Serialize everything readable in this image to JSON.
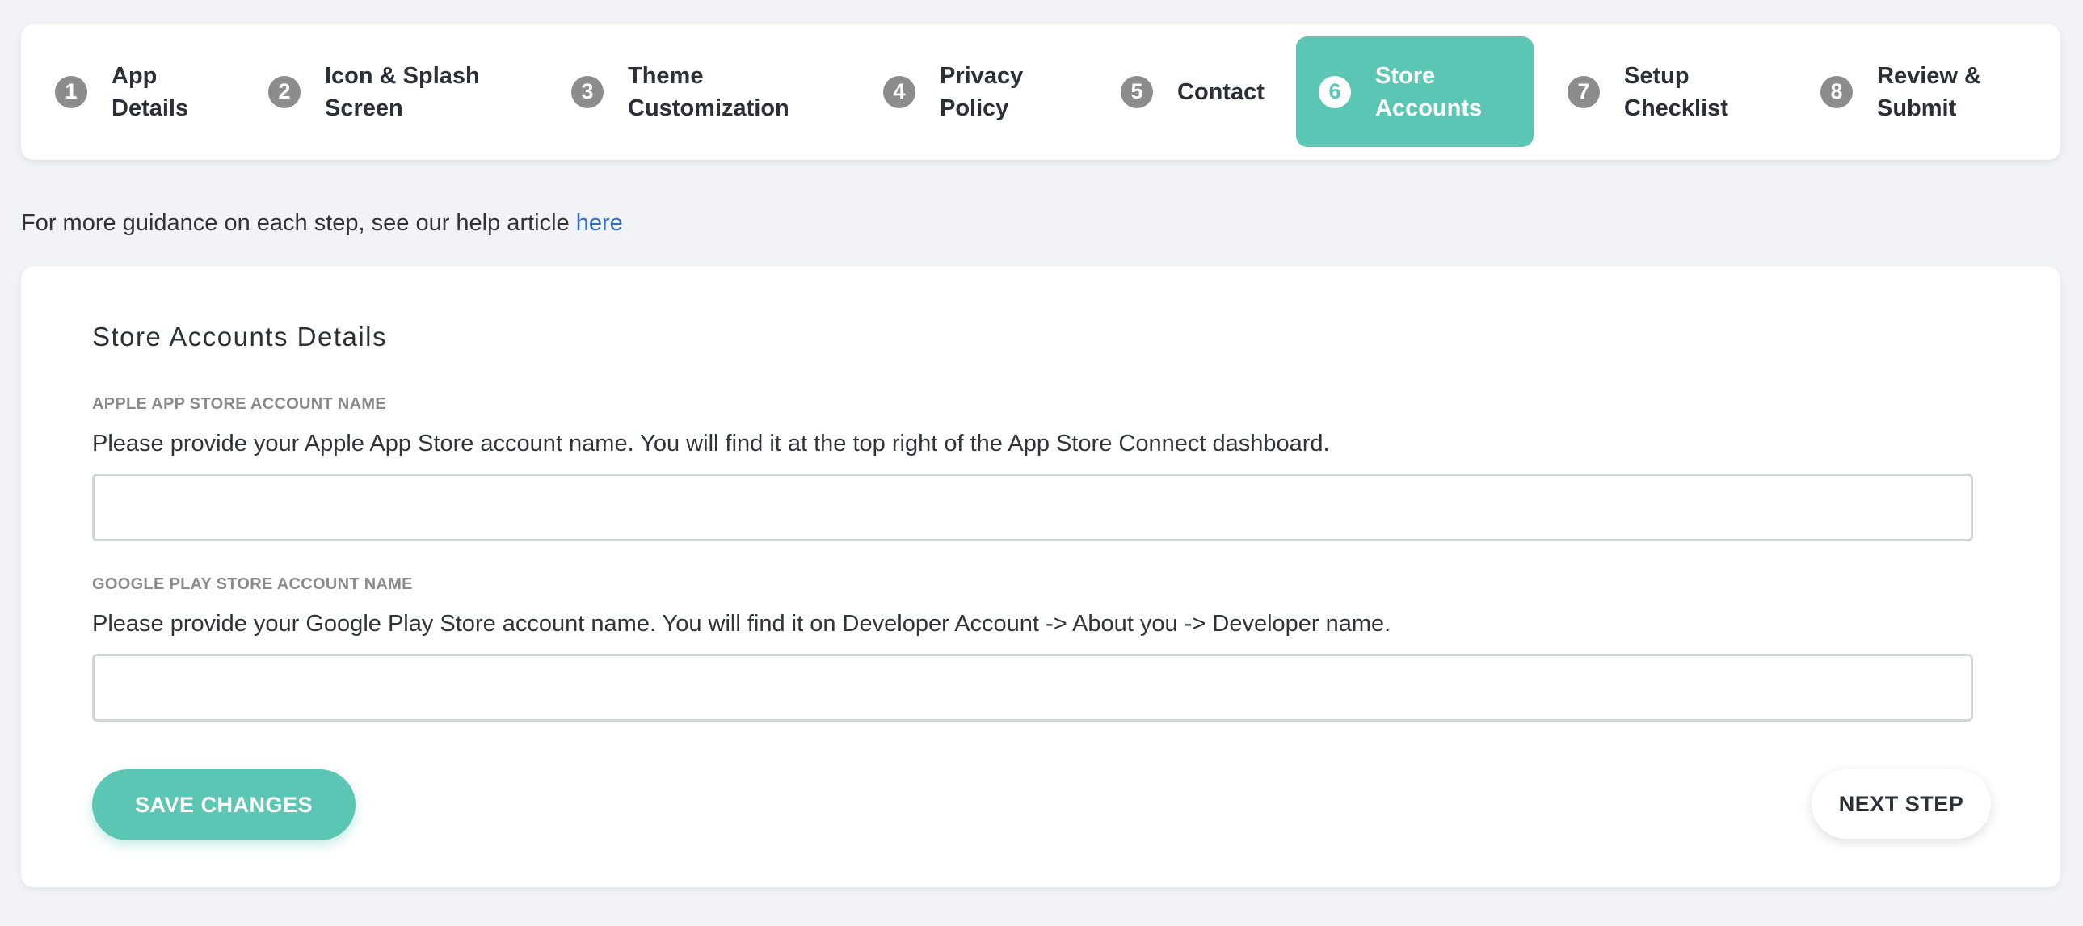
{
  "stepper": {
    "steps": [
      {
        "number": "1",
        "label_line1": "App",
        "label_line2": "Details",
        "active": false
      },
      {
        "number": "2",
        "label_line1": "Icon & Splash",
        "label_line2": "Screen",
        "active": false
      },
      {
        "number": "3",
        "label_line1": "Theme",
        "label_line2": "Customization",
        "active": false
      },
      {
        "number": "4",
        "label_line1": "Privacy",
        "label_line2": "Policy",
        "active": false
      },
      {
        "number": "5",
        "label_line1": "Contact",
        "label_line2": "",
        "active": false
      },
      {
        "number": "6",
        "label_line1": "Store",
        "label_line2": "Accounts",
        "active": true
      },
      {
        "number": "7",
        "label_line1": "Setup",
        "label_line2": "Checklist",
        "active": false
      },
      {
        "number": "8",
        "label_line1": "Review &",
        "label_line2": "Submit",
        "active": false
      }
    ],
    "active_color": "#5cc6b4"
  },
  "guidance": {
    "text": "For more guidance on each step, see our help article ",
    "link_text": "here"
  },
  "form": {
    "title": "Store Accounts Details",
    "apple": {
      "label": "APPLE APP STORE ACCOUNT NAME",
      "help": "Please provide your Apple App Store account name. You will find it at the top right of the App Store Connect dashboard.",
      "value": ""
    },
    "google": {
      "label": "GOOGLE PLAY STORE ACCOUNT NAME",
      "help": "Please provide your Google Play Store account name. You will find it on Developer Account -> About you -> Developer name.",
      "value": ""
    },
    "save_label": "SAVE CHANGES",
    "next_label": "NEXT STEP"
  }
}
